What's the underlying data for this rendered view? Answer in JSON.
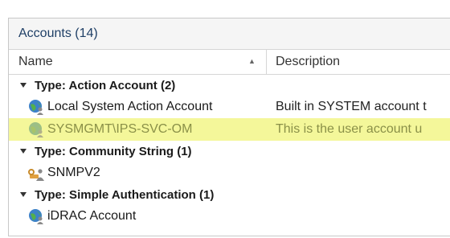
{
  "panel": {
    "title": "Accounts (14)"
  },
  "columns": {
    "name": "Name",
    "description": "Description"
  },
  "groups": [
    {
      "label": "Type: Action Account (2)",
      "rows": [
        {
          "icon": "globe-user-icon",
          "name": "Local System Action Account",
          "description": "Built in SYSTEM account t"
        },
        {
          "icon": "globe-user-icon",
          "name": "SYSMGMT\\IPS-SVC-OM",
          "description": "This is the user account u",
          "selected": true
        }
      ]
    },
    {
      "label": "Type: Community String (1)",
      "rows": [
        {
          "icon": "key-user-icon",
          "name": "SNMPV2",
          "description": ""
        }
      ]
    },
    {
      "label": "Type: Simple Authentication (1)",
      "rows": [
        {
          "icon": "globe-user-icon",
          "name": "iDRAC Account",
          "description": ""
        }
      ]
    }
  ],
  "colors": {
    "selection": "#f4f79a",
    "header_text": "#1f3f66"
  }
}
